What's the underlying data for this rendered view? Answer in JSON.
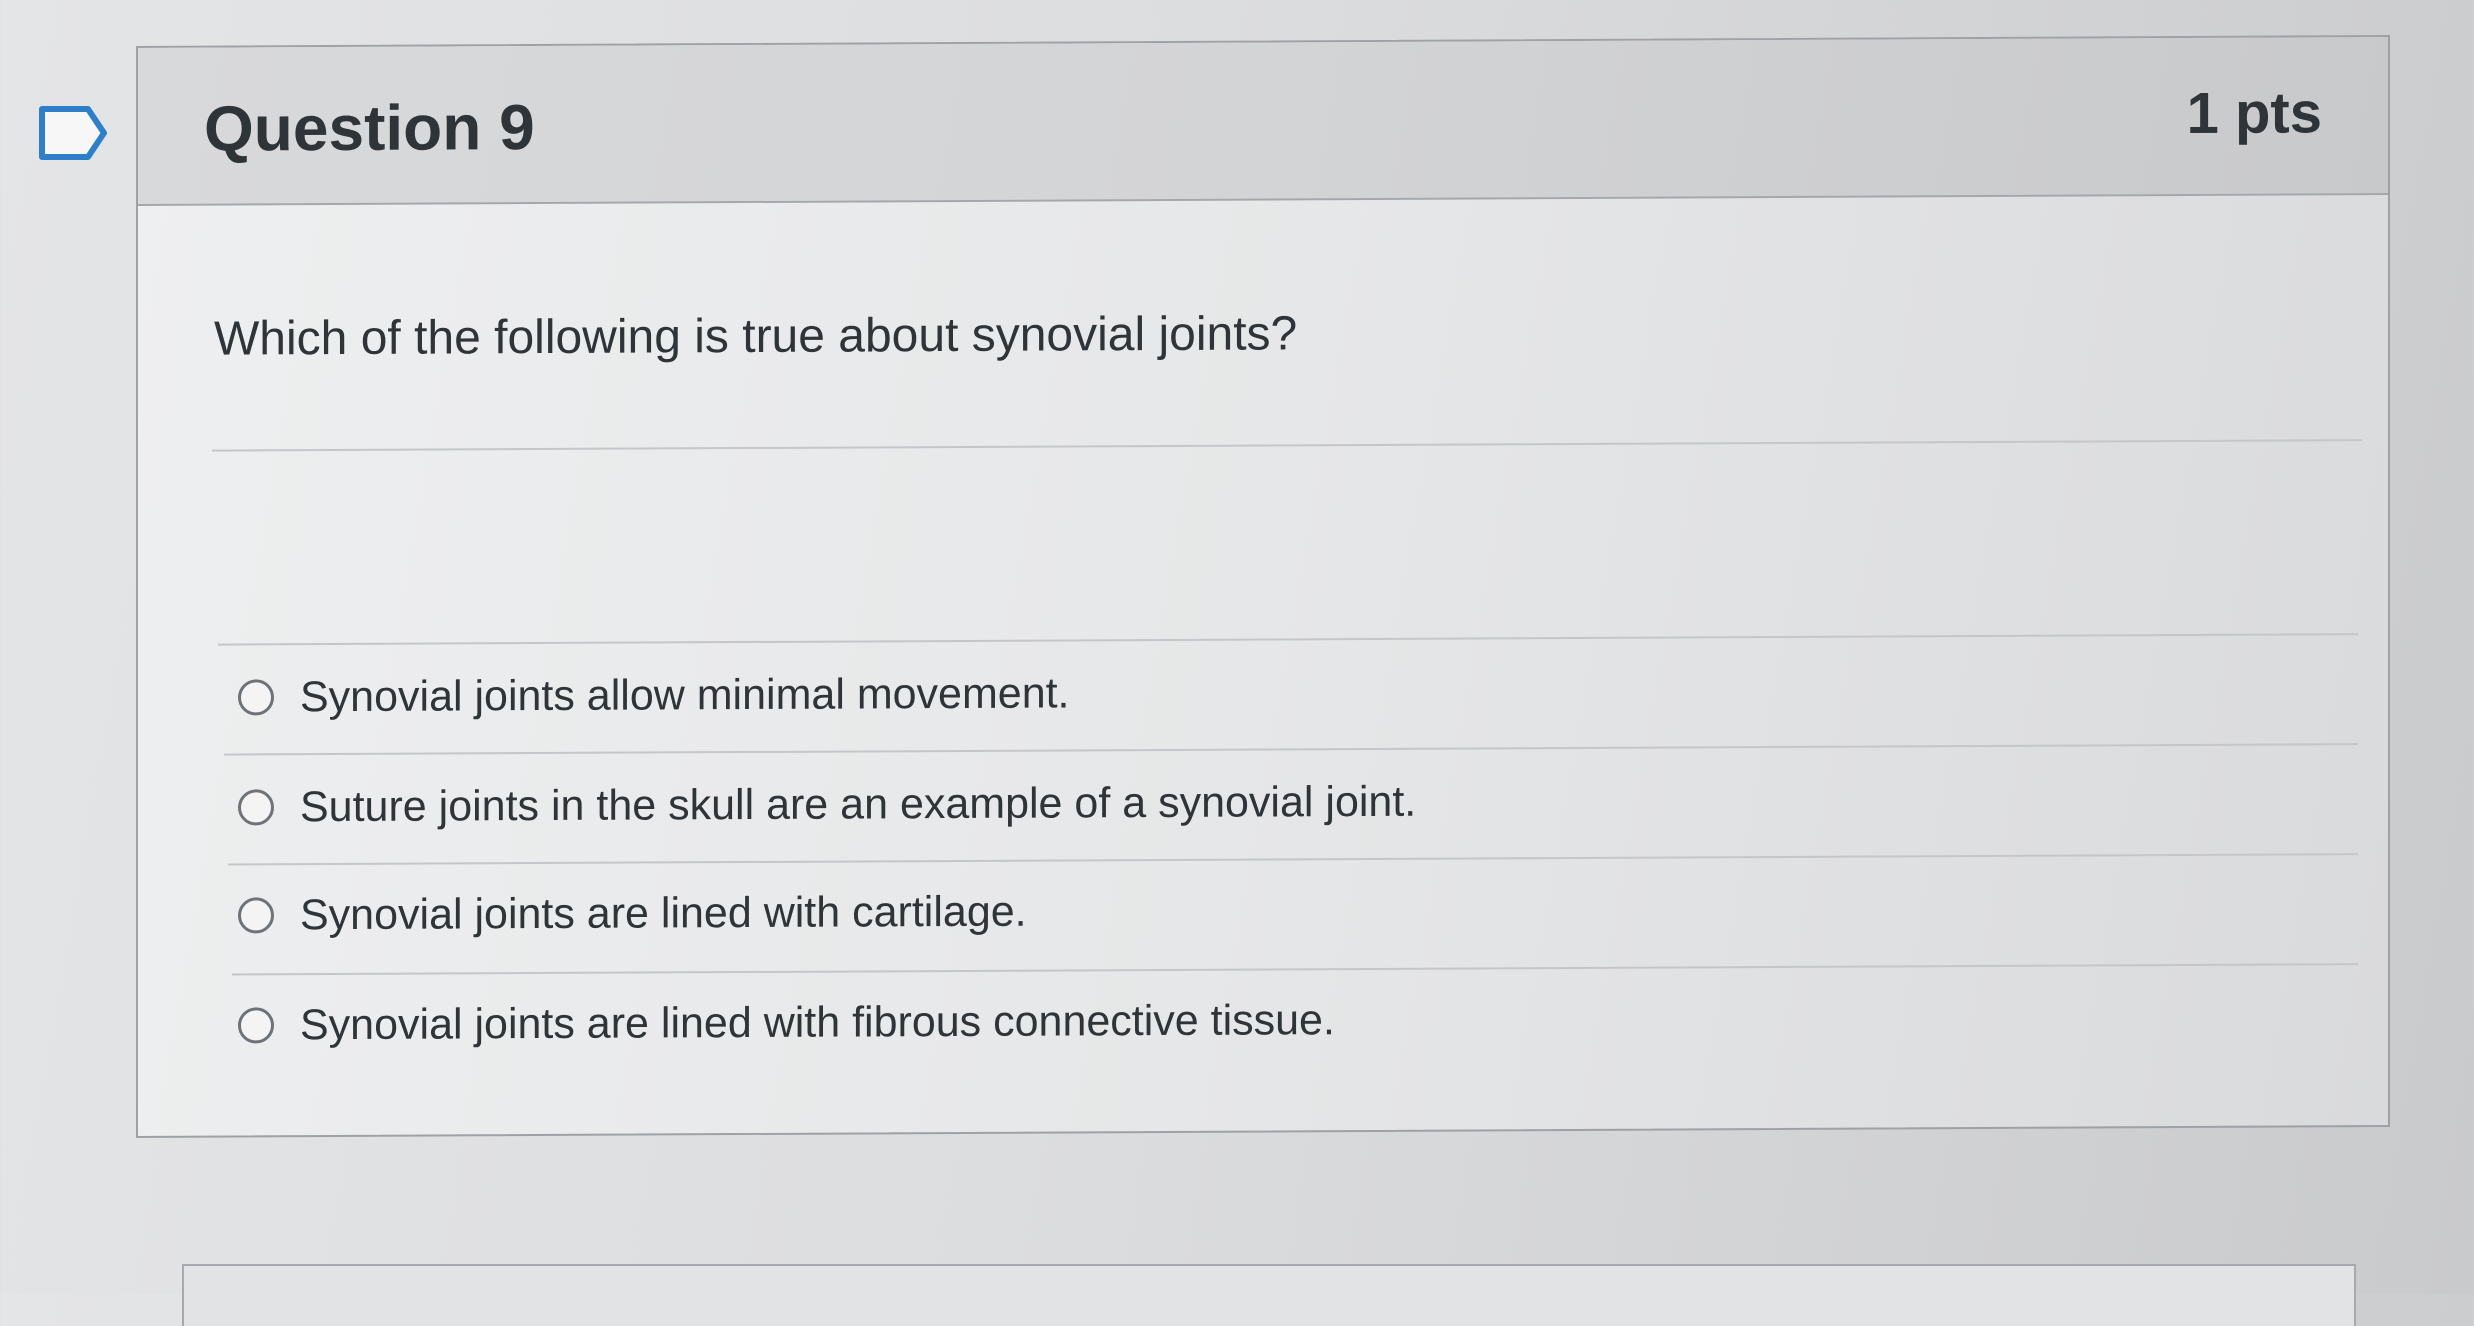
{
  "question": {
    "title": "Question 9",
    "points": "1 pts",
    "text": "Which of the following is true about synovial joints?",
    "flag_icon": "flag-icon",
    "answers": [
      {
        "label": "Synovial joints allow minimal movement.",
        "selected": false
      },
      {
        "label": "Suture joints in the skull are an example of a synovial joint.",
        "selected": false
      },
      {
        "label": "Synovial joints are lined with cartilage.",
        "selected": false
      },
      {
        "label": "Synovial joints are lined with fibrous connective tissue.",
        "selected": false
      }
    ]
  },
  "colors": {
    "header_bg": "#d3d4d6",
    "text": "#2f3438",
    "border": "#9ea2a6"
  }
}
